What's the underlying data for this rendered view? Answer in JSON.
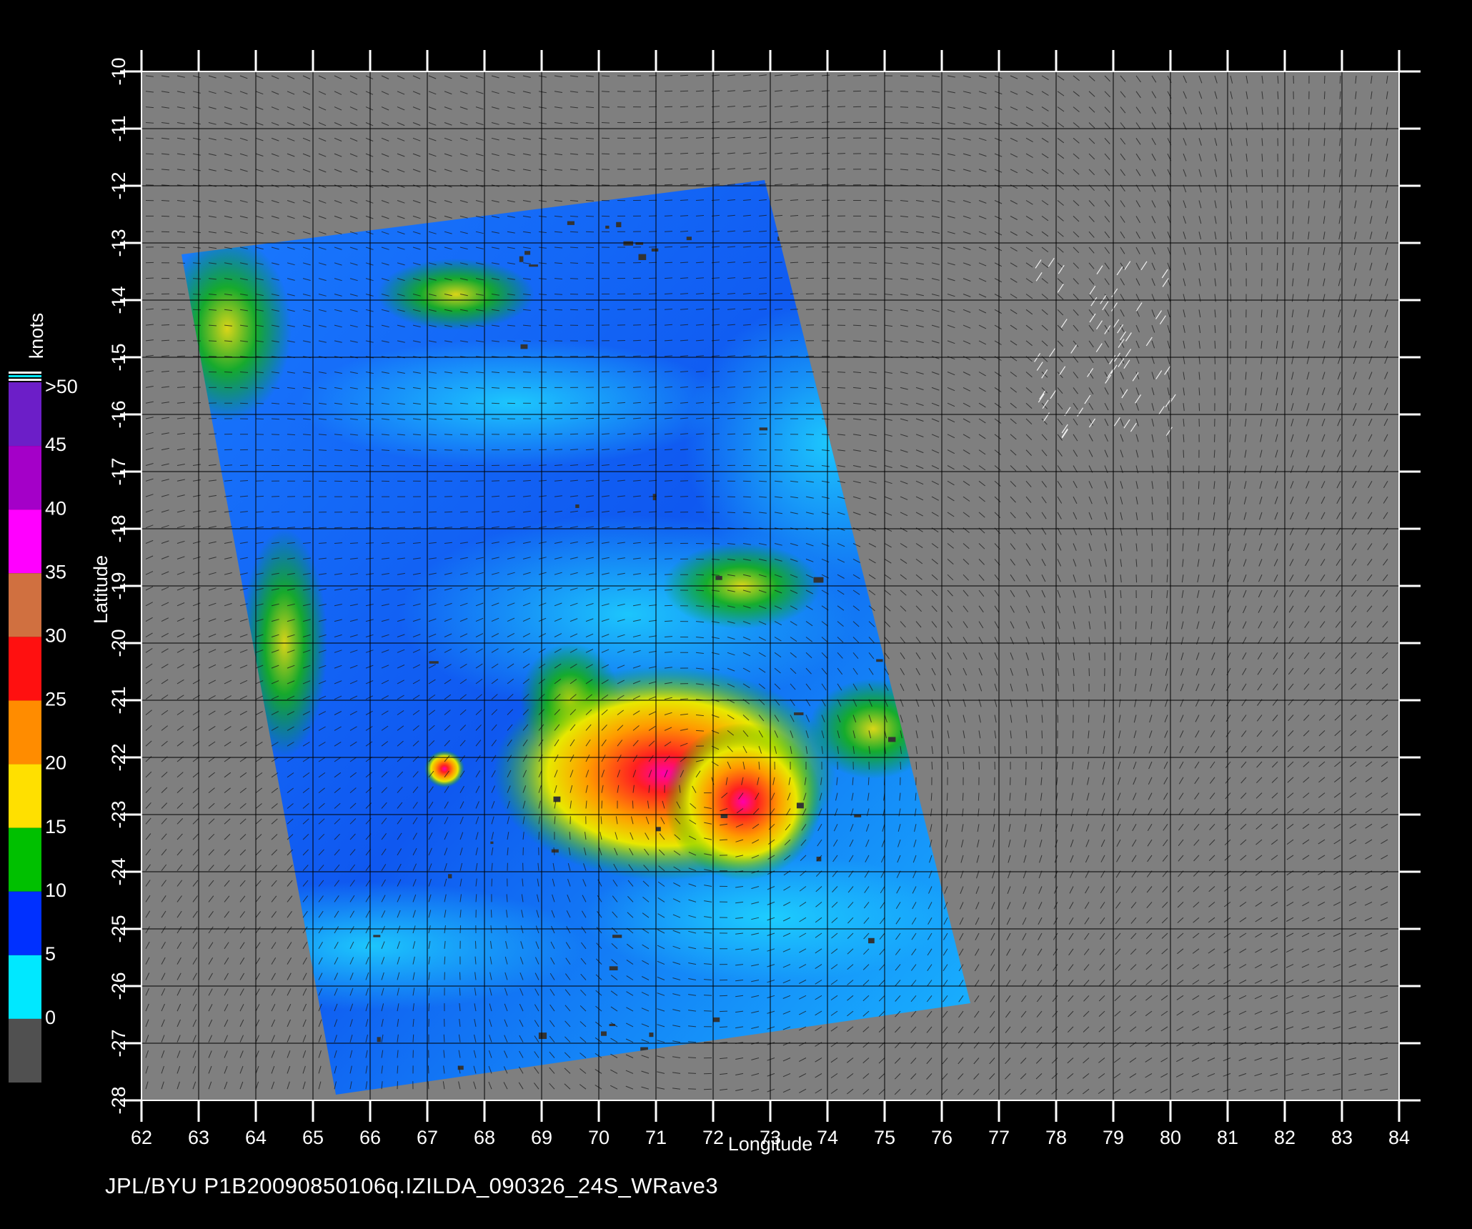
{
  "map": {
    "xlabel": "Longitude",
    "ylabel": "Latitude",
    "lon_range": [
      62,
      84
    ],
    "lat_range": [
      -28,
      -10
    ],
    "lon_ticks": [
      "62",
      "63",
      "64",
      "65",
      "66",
      "67",
      "68",
      "69",
      "70",
      "71",
      "72",
      "73",
      "74",
      "75",
      "76",
      "77",
      "78",
      "79",
      "80",
      "81",
      "82",
      "83",
      "84"
    ],
    "lat_ticks": [
      "-10",
      "-11",
      "-12",
      "-13",
      "-14",
      "-15",
      "-16",
      "-17",
      "-18",
      "-19",
      "-20",
      "-21",
      "-22",
      "-23",
      "-24",
      "-25",
      "-26",
      "-27",
      "-28"
    ],
    "background_color": "#7f7f7f",
    "swath_corners_lonlat": [
      [
        62.7,
        -13.2
      ],
      [
        72.9,
        -11.9
      ],
      [
        76.5,
        -26.3
      ],
      [
        65.4,
        -27.9
      ]
    ],
    "storm_center_lonlat": [
      71.9,
      -22.4
    ]
  },
  "legend": {
    "unit_label": "knots",
    "levels": [
      {
        "label": ">50",
        "color": "#6c1ec8"
      },
      {
        "label": "45",
        "color": "#a400c8"
      },
      {
        "label": "40",
        "color": "#ff00ff"
      },
      {
        "label": "35",
        "color": "#d07040"
      },
      {
        "label": "30",
        "color": "#ff1010"
      },
      {
        "label": "25",
        "color": "#ff8c00"
      },
      {
        "label": "20",
        "color": "#ffe000"
      },
      {
        "label": "15",
        "color": "#00c000"
      },
      {
        "label": "10",
        "color": "#0030ff"
      },
      {
        "label": "5",
        "color": "#00e8ff"
      },
      {
        "label": "0",
        "color": "#505050"
      }
    ]
  },
  "footer": {
    "text": "JPL/BYU  P1B20090850106q.IZILDA_090326_24S_WRave3"
  }
}
